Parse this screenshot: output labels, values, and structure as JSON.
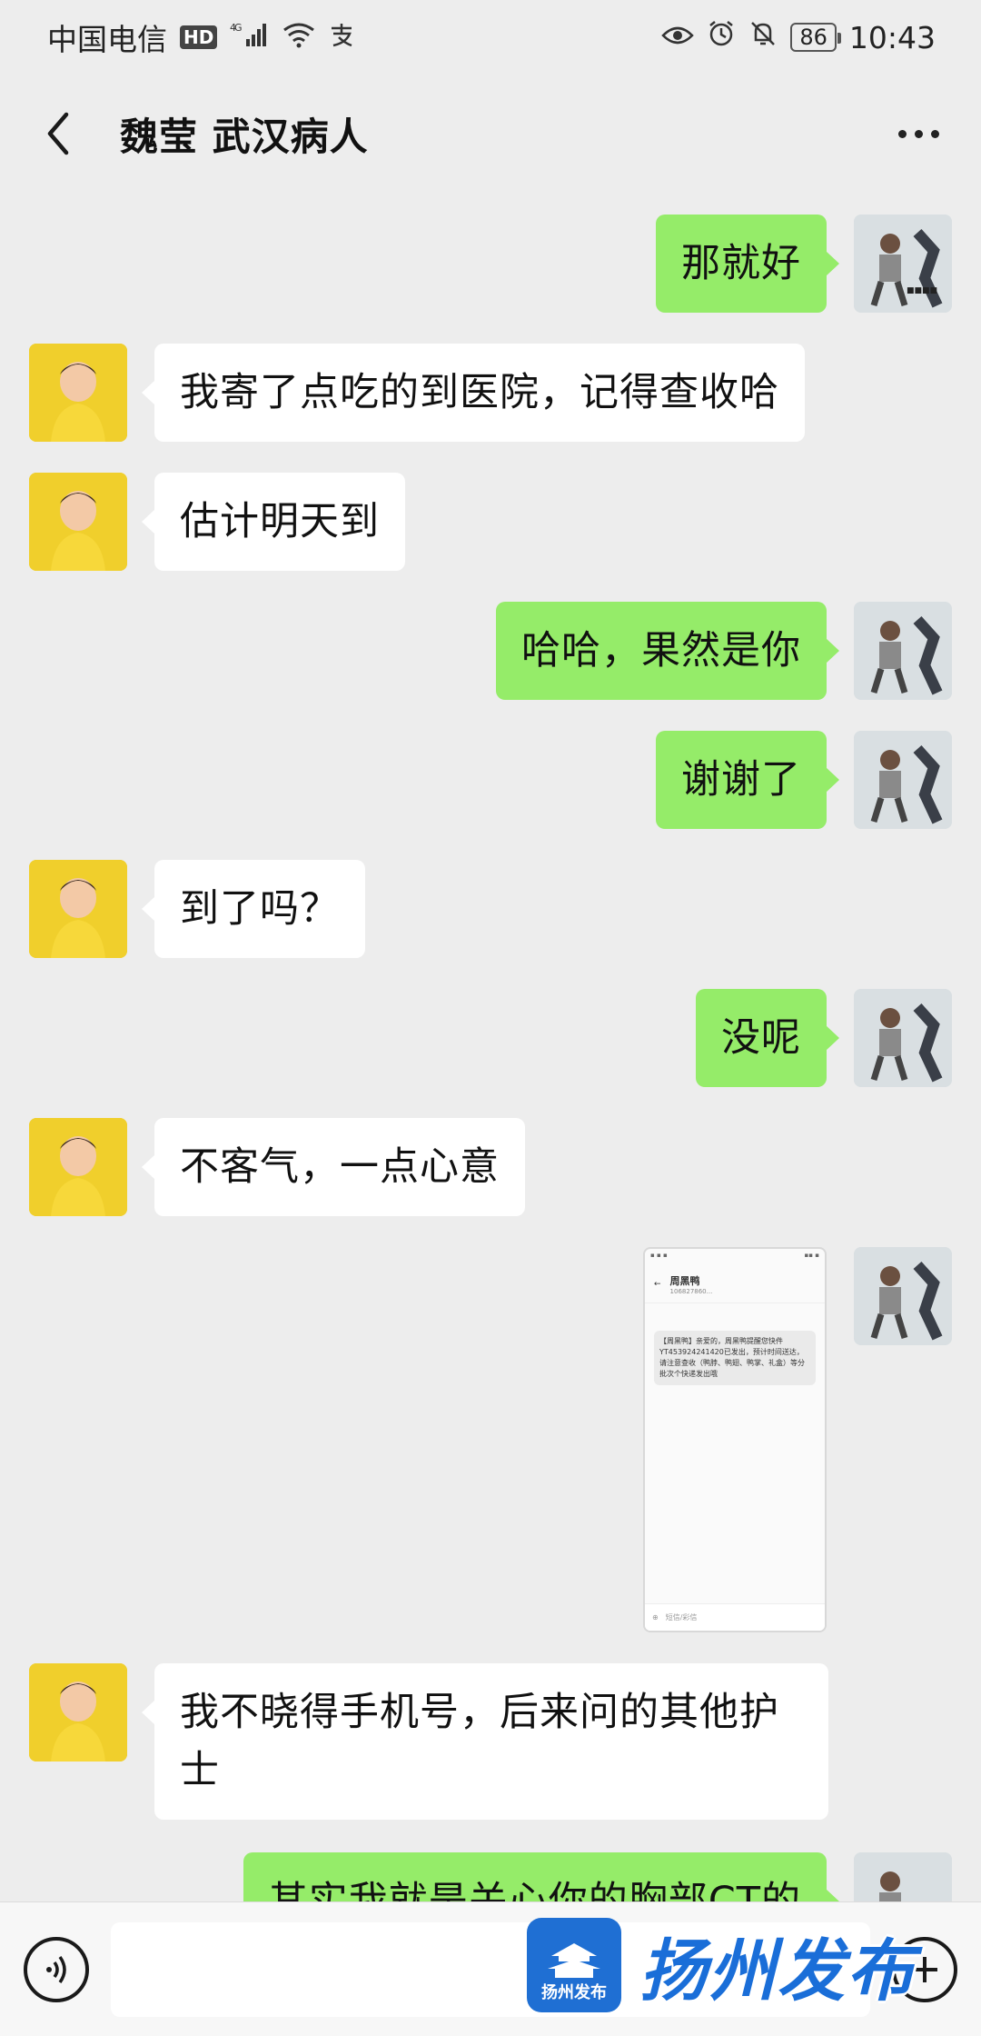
{
  "status_bar": {
    "carrier": "中国电信",
    "hd": "HD",
    "network": "4G",
    "battery": "86",
    "time": "10:43"
  },
  "header": {
    "title": "魏莹 武汉病人"
  },
  "messages": [
    {
      "side": "right",
      "text": "那就好"
    },
    {
      "side": "left",
      "text": "我寄了点吃的到医院，记得查收哈"
    },
    {
      "side": "left",
      "text": "估计明天到"
    },
    {
      "side": "right",
      "text": "哈哈，果然是你"
    },
    {
      "side": "right",
      "text": "谢谢了"
    },
    {
      "side": "left",
      "text": "到了吗？"
    },
    {
      "side": "right",
      "text": "没呢"
    },
    {
      "side": "left",
      "text": "不客气，一点心意"
    },
    {
      "side": "right",
      "type": "image",
      "image": {
        "sms_contact": "周黑鸭",
        "sms_number": "106827860...",
        "sms_body": "【周黑鸭】亲爱的，周黑鸭提醒您快件YT453924241420已发出，预计时间送达，请注意查收（鸭脖、鸭翅、鸭掌、礼盒）等分批次个快递发出哦",
        "sms_input_placeholder": "短信/彩信"
      }
    },
    {
      "side": "left",
      "text": "我不晓得手机号，后来问的其他护士"
    },
    {
      "side": "right",
      "text": "其实我就是关心你的胸部CT的"
    }
  ],
  "watermark": {
    "logo_text": "扬州发布",
    "brand_text": "扬州发布"
  },
  "colors": {
    "background": "#ededed",
    "my_bubble": "#95ec69",
    "their_bubble": "#ffffff",
    "watermark_blue": "#1a6ed8"
  },
  "icons": {
    "back": "back-arrow-icon",
    "more": "more-dots-icon",
    "voice": "voice-icon",
    "plus": "plus-icon",
    "eye": "eye-icon",
    "alarm": "alarm-icon",
    "mute": "bell-off-icon",
    "wifi": "wifi-icon"
  }
}
